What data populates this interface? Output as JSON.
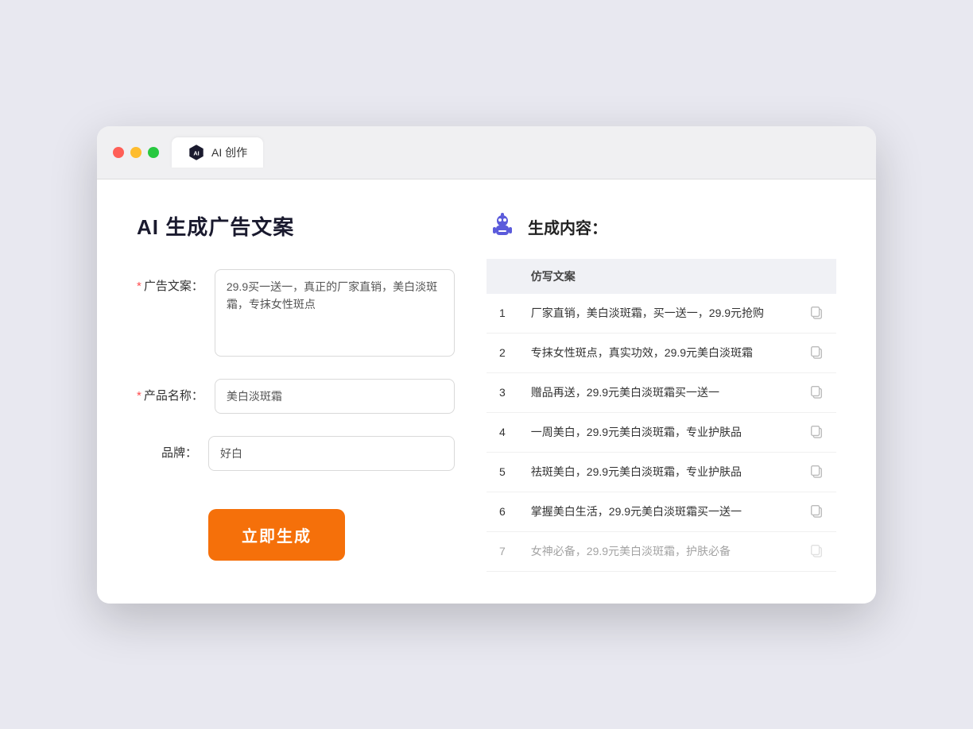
{
  "browser": {
    "tab_label": "AI 创作"
  },
  "page": {
    "title": "AI 生成广告文案",
    "results_title": "生成内容："
  },
  "form": {
    "ad_copy_label": "广告文案：",
    "ad_copy_required": "*",
    "ad_copy_value": "29.9买一送一，真正的厂家直销，美白淡斑霜，专抹女性斑点",
    "product_name_label": "产品名称：",
    "product_name_required": "*",
    "product_name_value": "美白淡斑霜",
    "brand_label": "品牌：",
    "brand_value": "好白",
    "generate_button": "立即生成"
  },
  "results": {
    "column_header": "仿写文案",
    "items": [
      {
        "num": "1",
        "text": "厂家直销，美白淡斑霜，买一送一，29.9元抢购"
      },
      {
        "num": "2",
        "text": "专抹女性斑点，真实功效，29.9元美白淡斑霜"
      },
      {
        "num": "3",
        "text": "赠品再送，29.9元美白淡斑霜买一送一"
      },
      {
        "num": "4",
        "text": "一周美白，29.9元美白淡斑霜，专业护肤品"
      },
      {
        "num": "5",
        "text": "祛斑美白，29.9元美白淡斑霜，专业护肤品"
      },
      {
        "num": "6",
        "text": "掌握美白生活，29.9元美白淡斑霜买一送一"
      },
      {
        "num": "7",
        "text": "女神必备，29.9元美白淡斑霜，护肤必备"
      }
    ]
  }
}
